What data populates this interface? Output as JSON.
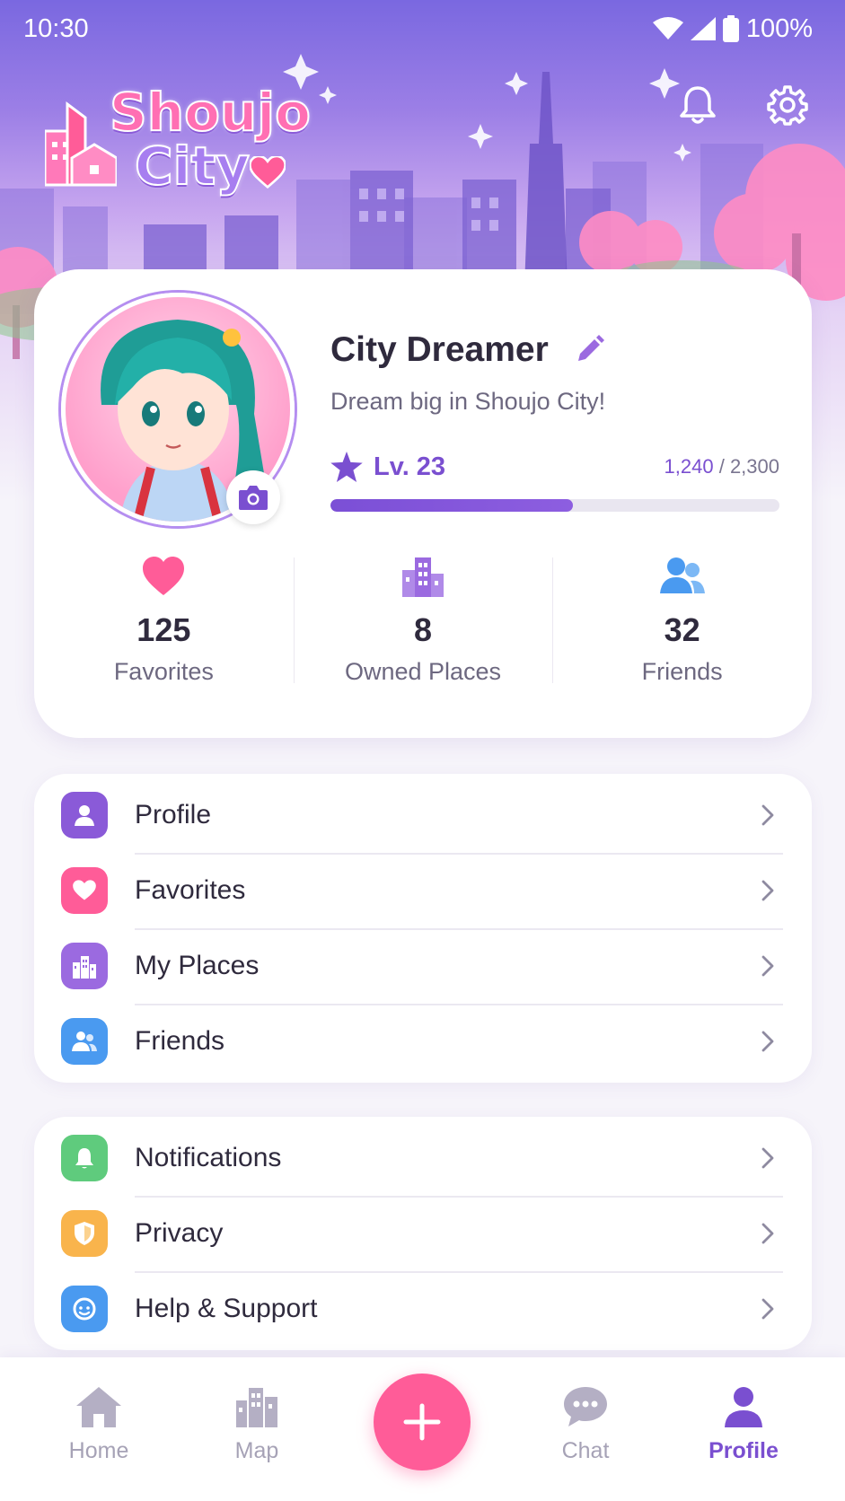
{
  "status_bar": {
    "time": "10:30",
    "battery": "100%"
  },
  "app": {
    "logo_line1": "Shoujo",
    "logo_line2": "City"
  },
  "profile": {
    "name": "City Dreamer",
    "bio": "Dream big in Shoujo City!",
    "level": "Lv. 23",
    "xp_current": "1,240",
    "xp_separator": " / ",
    "xp_total": "2,300",
    "xp_progress_fraction": 0.5391
  },
  "stats": [
    {
      "icon": "heart-icon",
      "value": "125",
      "label": "Favorites",
      "color": "#ff5c98"
    },
    {
      "icon": "buildings-icon",
      "value": "8",
      "label": "Owned Places",
      "color": "#9b6ae0"
    },
    {
      "icon": "friends-icon",
      "value": "32",
      "label": "Friends",
      "color": "#4a9af0"
    }
  ],
  "menu_group_1": [
    {
      "label": "Profile",
      "icon": "user-icon",
      "color": "#8a5ad8"
    },
    {
      "label": "Favorites",
      "icon": "heart-icon",
      "color": "#ff5c98"
    },
    {
      "label": "My Places",
      "icon": "buildings-icon",
      "color": "#9b6ae0"
    },
    {
      "label": "Friends",
      "icon": "friends-icon",
      "color": "#4a9af0"
    }
  ],
  "menu_group_2": [
    {
      "label": "Notifications",
      "icon": "bell-icon",
      "color": "#5fcb7d"
    },
    {
      "label": "Privacy",
      "icon": "shield-icon",
      "color": "#f9b44c"
    },
    {
      "label": "Help & Support",
      "icon": "support-icon",
      "color": "#4a9af0"
    }
  ],
  "bottom_nav": [
    {
      "label": "Home",
      "icon": "home-icon"
    },
    {
      "label": "Map",
      "icon": "map-icon"
    },
    {
      "label": "Chat",
      "icon": "chat-icon"
    },
    {
      "label": "Profile",
      "icon": "profile-icon",
      "active": true
    }
  ],
  "colors": {
    "accent": "#7a4fd0",
    "fab": "#ff5c98"
  }
}
